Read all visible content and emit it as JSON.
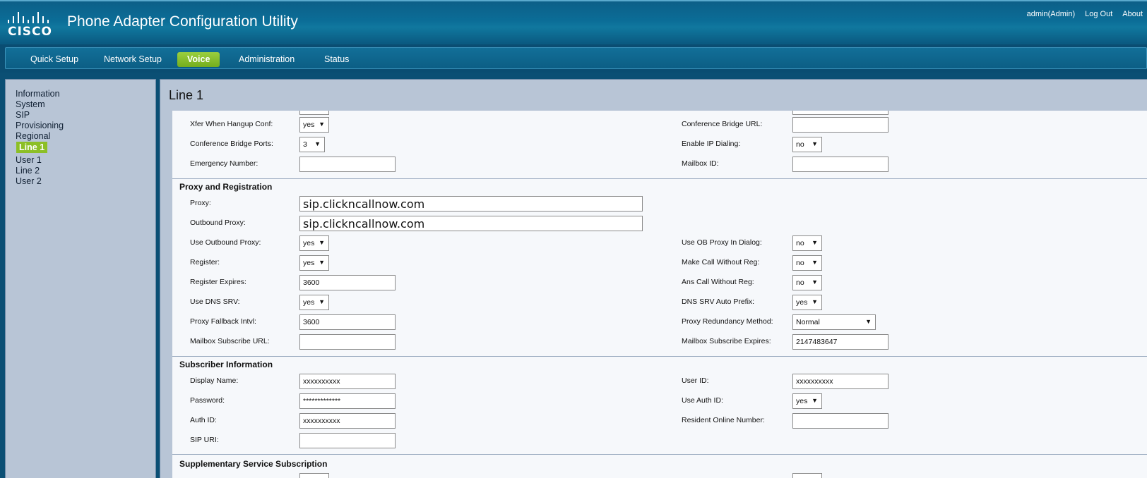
{
  "header": {
    "brand": "CISCO",
    "title": "Phone Adapter Configuration Utility",
    "user": "admin(Admin)",
    "logout": "Log Out",
    "about": "About"
  },
  "nav": [
    "Quick Setup",
    "Network Setup",
    "Voice",
    "Administration",
    "Status"
  ],
  "nav_active": "Voice",
  "sidebar": [
    "Information",
    "System",
    "SIP",
    "Provisioning",
    "Regional",
    "Line 1",
    "User 1",
    "Line 2",
    "User 2"
  ],
  "sidebar_active": "Line 1",
  "page_title": "Line 1",
  "top_rows": {
    "xfer_when_hangup_conf": {
      "label": "Xfer When Hangup Conf:",
      "value": "yes"
    },
    "conference_bridge_url": {
      "label": "Conference Bridge URL:",
      "value": ""
    },
    "conference_bridge_ports": {
      "label": "Conference Bridge Ports:",
      "value": "3"
    },
    "enable_ip_dialing": {
      "label": "Enable IP Dialing:",
      "value": "no"
    },
    "emergency_number": {
      "label": "Emergency Number:",
      "value": ""
    },
    "mailbox_id": {
      "label": "Mailbox ID:",
      "value": ""
    }
  },
  "proxy": {
    "section": "Proxy and Registration",
    "proxy": {
      "label": "Proxy:",
      "value": "sip.clickncallnow.com"
    },
    "outbound_proxy": {
      "label": "Outbound Proxy:",
      "value": "sip.clickncallnow.com"
    },
    "use_outbound_proxy": {
      "label": "Use Outbound Proxy:",
      "value": "yes"
    },
    "use_ob_proxy_in_dialog": {
      "label": "Use OB Proxy In Dialog:",
      "value": "no"
    },
    "register": {
      "label": "Register:",
      "value": "yes"
    },
    "make_call_without_reg": {
      "label": "Make Call Without Reg:",
      "value": "no"
    },
    "register_expires": {
      "label": "Register Expires:",
      "value": "3600"
    },
    "ans_call_without_reg": {
      "label": "Ans Call Without Reg:",
      "value": "no"
    },
    "use_dns_srv": {
      "label": "Use DNS SRV:",
      "value": "yes"
    },
    "dns_srv_auto_prefix": {
      "label": "DNS SRV Auto Prefix:",
      "value": "yes"
    },
    "proxy_fallback_intvl": {
      "label": "Proxy Fallback Intvl:",
      "value": "3600"
    },
    "proxy_redundancy_method": {
      "label": "Proxy Redundancy Method:",
      "value": "Normal"
    },
    "mailbox_subscribe_url": {
      "label": "Mailbox Subscribe URL:",
      "value": ""
    },
    "mailbox_subscribe_expires": {
      "label": "Mailbox Subscribe Expires:",
      "value": "2147483647"
    }
  },
  "subscriber": {
    "section": "Subscriber Information",
    "display_name": {
      "label": "Display Name:",
      "value": "xxxxxxxxxx"
    },
    "user_id": {
      "label": "User ID:",
      "value": "xxxxxxxxxx"
    },
    "password": {
      "label": "Password:",
      "value": "*************"
    },
    "use_auth_id": {
      "label": "Use Auth ID:",
      "value": "yes"
    },
    "auth_id": {
      "label": "Auth ID:",
      "value": "xxxxxxxxxx"
    },
    "resident_online_number": {
      "label": "Resident Online Number:",
      "value": ""
    },
    "sip_uri": {
      "label": "SIP URI:",
      "value": ""
    }
  },
  "supplementary": {
    "section": "Supplementary Service Subscription"
  }
}
